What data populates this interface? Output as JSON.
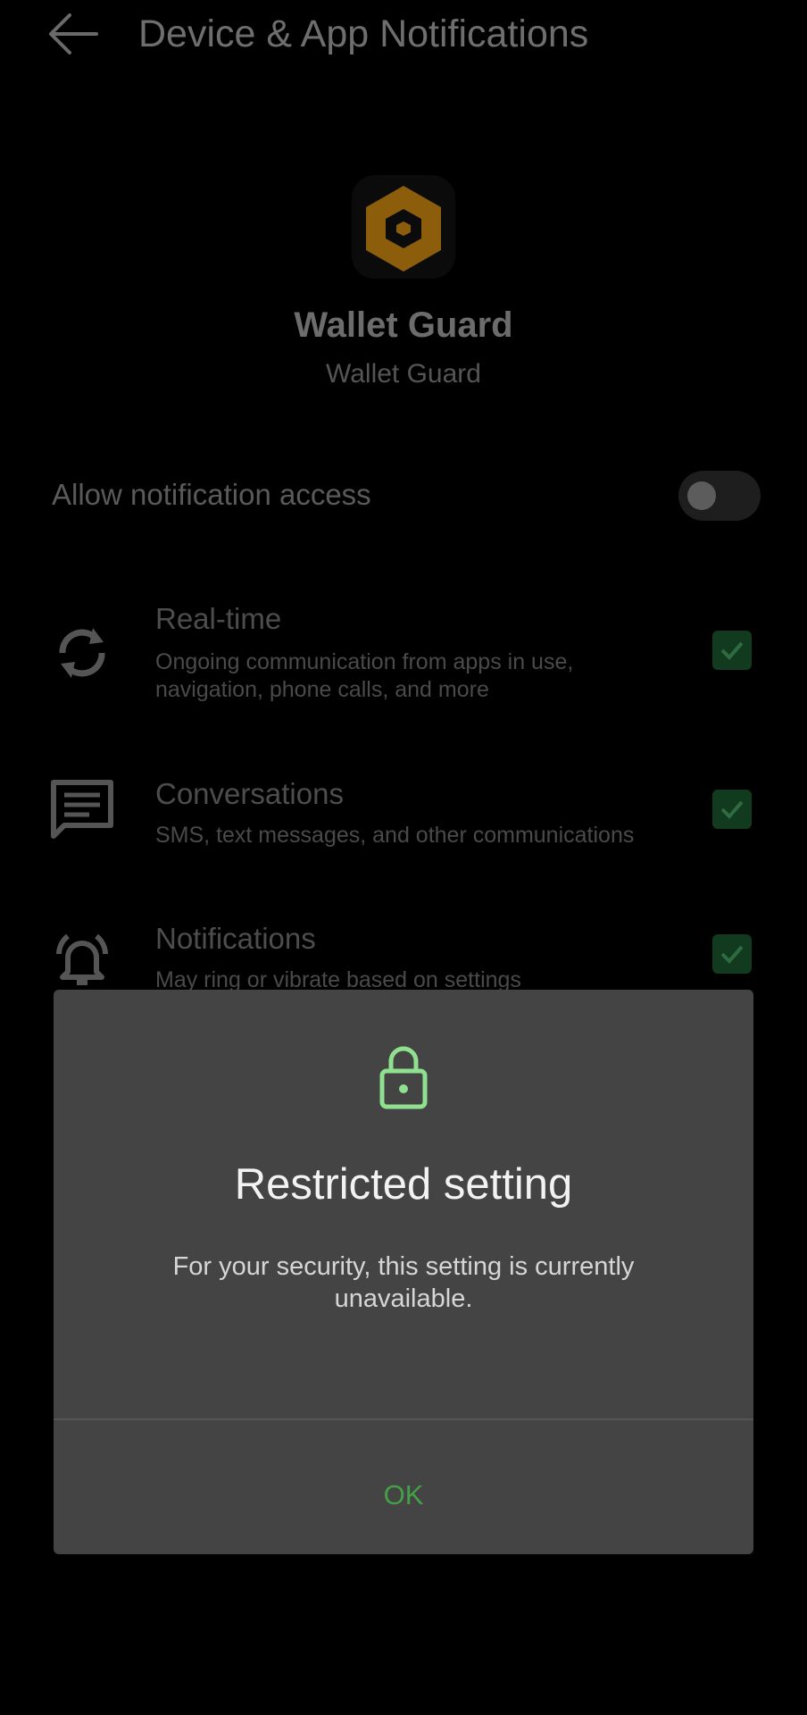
{
  "header": {
    "title": "Device & App Notifications"
  },
  "app": {
    "name": "Wallet Guard",
    "subtitle": "Wallet Guard"
  },
  "allow": {
    "label": "Allow notification access",
    "enabled": false
  },
  "categories": [
    {
      "label": "Real-time",
      "description": "Ongoing communication from apps in use, navigation, phone calls, and more",
      "checked": true
    },
    {
      "label": "Conversations",
      "description": "SMS, text messages, and other communications",
      "checked": true
    },
    {
      "label": "Notifications",
      "description": "May ring or vibrate based on settings",
      "checked": true
    }
  ],
  "dialog": {
    "title": "Restricted setting",
    "body": "For your security, this setting is currently unavailable.",
    "ok_label": "OK"
  },
  "colors": {
    "accent": "#43a047",
    "lock": "#8fe08f",
    "app_icon": "#c88a12"
  }
}
